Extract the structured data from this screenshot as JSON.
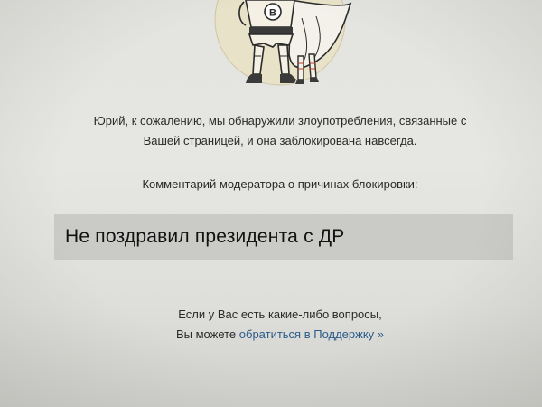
{
  "block_notice": {
    "line1": "Юрий, к сожалению, мы обнаружили злоупотребления, связанные с",
    "line2": "Вашей страницей, и она заблокирована навсегда.",
    "comment_label": "Комментарий модератора о причинах блокировки:",
    "reason": "Не поздравил президента с ДР"
  },
  "support": {
    "line1": "Если у Вас есть какие-либо вопросы,",
    "line2_prefix": "Вы можете ",
    "link_label": "обратиться в Поддержку »"
  },
  "mascot": {
    "icon": "superhero-mascot-icon",
    "emblem_letter": "B"
  },
  "colors": {
    "background": "#e3e3df",
    "reason_box": "#cacac6",
    "link": "#2b5c8a",
    "text": "#2a2a2a"
  }
}
